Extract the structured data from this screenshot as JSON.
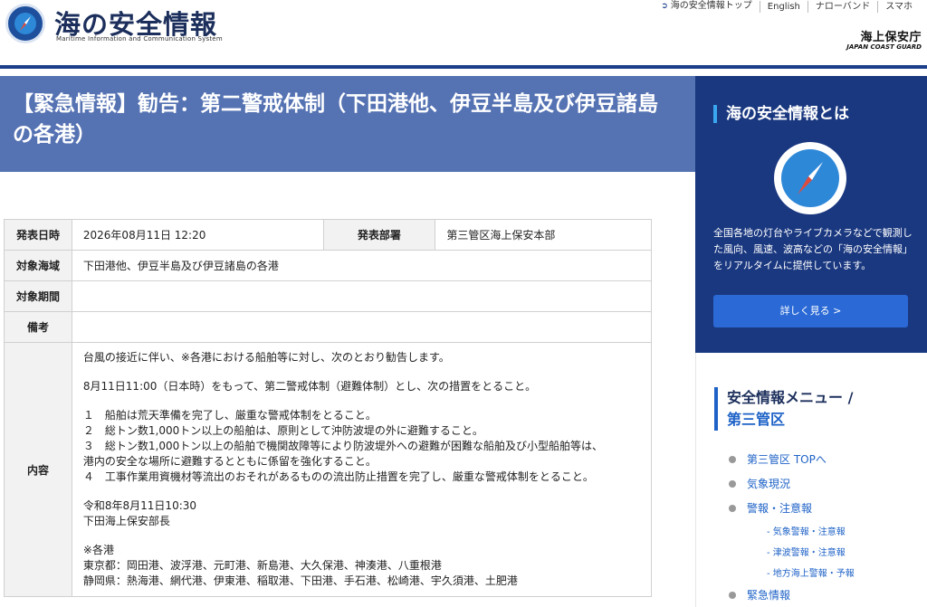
{
  "header": {
    "site_title": "海の安全情報",
    "site_subtitle": "Maritime Information and Communication System",
    "top_links": [
      "海の安全情報トップ",
      "English",
      "ナローバンド",
      "スマホ"
    ],
    "agency_jp": "海上保安庁",
    "agency_en": "JAPAN COAST GUARD"
  },
  "page_title": "【緊急情報】勧告：第二警戒体制（下田港他、伊豆半島及び伊豆諸島の各港）",
  "table": {
    "issued_at_label": "発表日時",
    "issued_at_value": "2026年08月11日 12:20",
    "dept_label": "発表部署",
    "dept_value": "第三管区海上保安本部",
    "area_label": "対象海域",
    "area_value": "下田港他、伊豆半島及び伊豆諸島の各港",
    "period_label": "対象期間",
    "period_value": "",
    "remarks_label": "備考",
    "remarks_value": "",
    "content_label": "内容",
    "content": {
      "intro": "台風の接近に伴い、※各港における船舶等に対し、次のとおり勧告します。",
      "measure_intro": "8月11日11:00（日本時）をもって、第二警戒体制（避難体制）とし、次の措置をとること。",
      "item1": "１　船舶は荒天準備を完了し、厳重な警戒体制をとること。",
      "item2": "２　総トン数1,000トン以上の船舶は、原則として沖防波堤の外に避難すること。",
      "item3a": "３　総トン数1,000トン以上の船舶で機関故障等により防波堤外への避難が困難な船舶及び小型船舶等は、",
      "item3b": "港内の安全な場所に避難するとともに係留を強化すること。",
      "item4": "４　工事作業用資機材等流出のおそれがあるものの流出防止措置を完了し、厳重な警戒体制をとること。",
      "date_line": "令和8年8月11日10:30",
      "signer": "下田海上保安部長",
      "ports_heading": "※各港",
      "ports_tokyo": "東京都：岡田港、波浮港、元町港、新島港、大久保港、神湊港、八重根港",
      "ports_shizuoka": "静岡県：熱海港、網代港、伊東港、稲取港、下田港、手石港、松崎港、宇久須港、土肥港"
    }
  },
  "sidebar": {
    "about_heading": "海の安全情報とは",
    "about_desc": "全国各地の灯台やライブカメラなどで観測した風向、風速、波高などの「海の安全情報」をリアルタイムに提供しています。",
    "about_button": "詳しく見る >",
    "menu_title_1": "安全情報メニュー /",
    "menu_title_2": "第三管区",
    "menu_items": [
      {
        "label": "第三管区 TOPへ"
      },
      {
        "label": "気象現況"
      },
      {
        "label": "警報・注意報"
      },
      {
        "label": "- 気象警報・注意報"
      },
      {
        "label": "- 津波警報・注意報"
      },
      {
        "label": "- 地方海上警報・予報"
      },
      {
        "label": "緊急情報"
      }
    ]
  }
}
